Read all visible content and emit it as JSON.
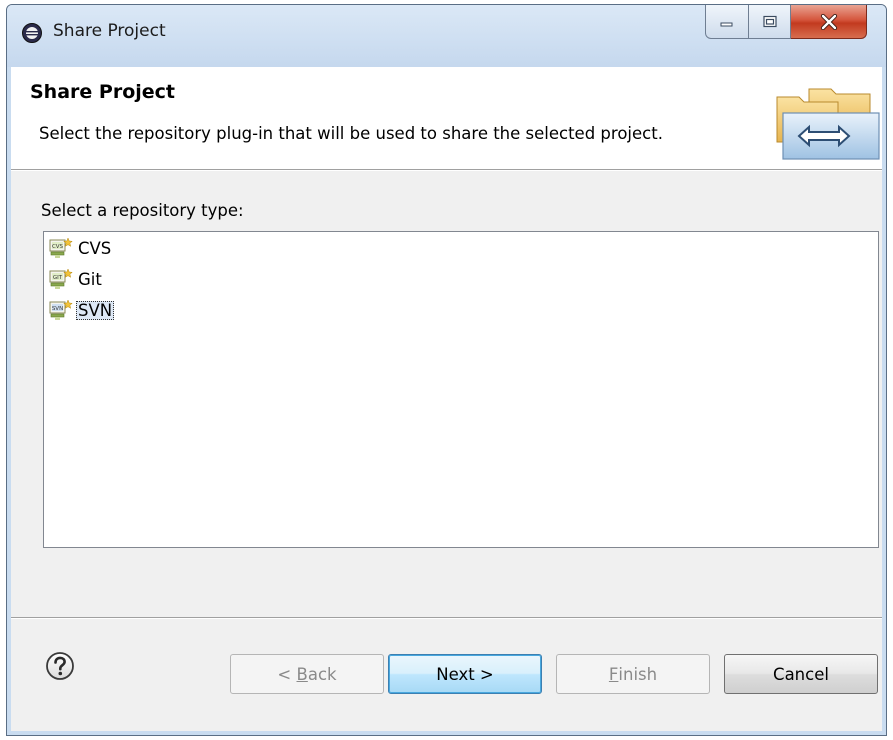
{
  "window": {
    "title": "Share Project"
  },
  "header": {
    "title": "Share Project",
    "description": "Select the repository plug-in that will be used to share the selected project."
  },
  "repository_list": {
    "label": "Select a repository type:",
    "items": [
      {
        "label": "CVS",
        "icon": "cvs-repo-icon",
        "selected": false
      },
      {
        "label": "Git",
        "icon": "git-repo-icon",
        "selected": false
      },
      {
        "label": "SVN",
        "icon": "svn-repo-icon",
        "selected": true
      }
    ]
  },
  "buttons": {
    "back": {
      "prefix": "< ",
      "mnemonic": "B",
      "rest": "ack",
      "enabled": false
    },
    "next": {
      "label": "Next >",
      "enabled": true
    },
    "finish": {
      "mnemonic": "F",
      "rest": "inish",
      "enabled": false
    },
    "cancel": {
      "label": "Cancel",
      "enabled": true
    }
  },
  "colors": {
    "title_bar": "#c5d8ee",
    "close_button": "#c8452b",
    "default_button_border": "#3c7fb1",
    "selection": "#dde8f6"
  }
}
